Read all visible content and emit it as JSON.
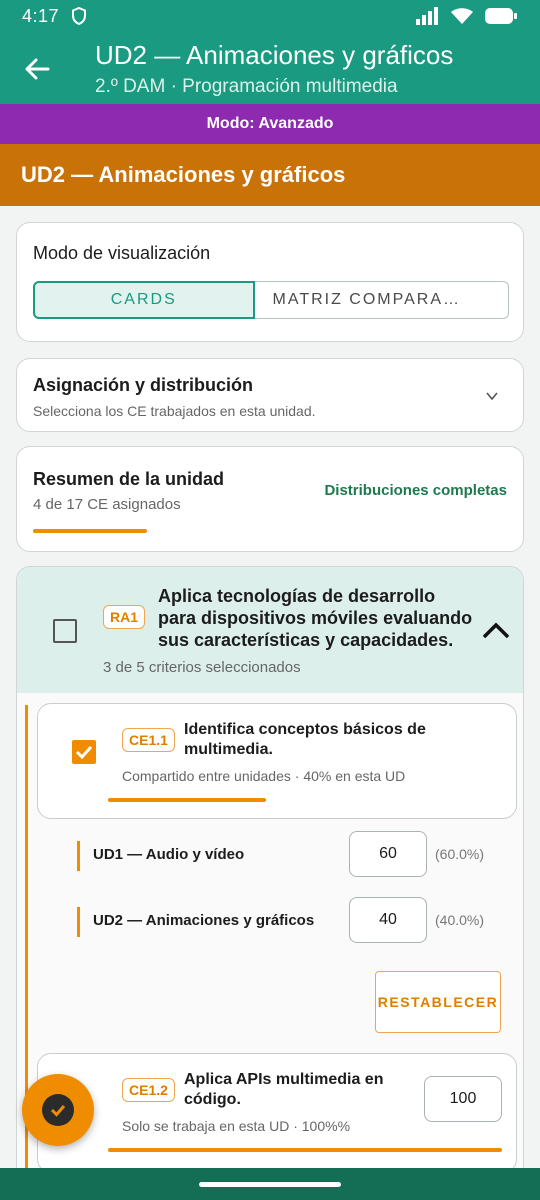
{
  "status_bar": {
    "time": "4:17"
  },
  "app_bar": {
    "title": "UD2 — Animaciones y gráficos",
    "subtitle": "2.º DAM · Programación multimedia"
  },
  "mode_strip": {
    "label": "Modo: Avanzado"
  },
  "unit_header": {
    "title": "UD2 — Animaciones y gráficos"
  },
  "view_mode": {
    "label": "Modo de visualización",
    "options": [
      "CARDS",
      "MATRIZ COMPARA…"
    ],
    "selected": "CARDS"
  },
  "assignment": {
    "title": "Asignación y distribución",
    "subtitle": "Selecciona los CE trabajados en esta unidad."
  },
  "summary": {
    "title": "Resumen de la unidad",
    "subtitle": "4 de 17 CE asignados",
    "status": "Distribuciones completas"
  },
  "ra": {
    "code": "RA1",
    "title": "Aplica tecnologías de desarrollo para dispositivos móviles evaluando sus características y capacidades.",
    "subtitle": "3 de 5 criterios seleccionados",
    "checked": false,
    "criteria": [
      {
        "code": "CE1.1",
        "title": "Identifica conceptos básicos de multimedia.",
        "subtitle": "Compartido entre unidades · 40% en esta UD",
        "checked": true,
        "distribution": [
          {
            "unit": "UD1 — Audio y vídeo",
            "value": "60",
            "percent": "(60.0%)"
          },
          {
            "unit": "UD2 — Animaciones y gráficos",
            "value": "40",
            "percent": "(40.0%)"
          }
        ],
        "reset_label": "RESTABLECER"
      },
      {
        "code": "CE1.2",
        "title": "Aplica APIs multimedia en código.",
        "subtitle": "Solo se trabaja en esta UD · 100%%",
        "value": "100"
      }
    ]
  },
  "colors": {
    "primary": "#1a9a80",
    "mode_strip": "#8e2aaf",
    "unit_header": "#c97208",
    "accent": "#f08c00",
    "success_text": "#1e7a4e"
  },
  "icons": {
    "back": "arrow-left-icon",
    "expand": "chevron-down-icon",
    "collapse": "chevron-up-icon",
    "fab": "check-circle-icon"
  }
}
